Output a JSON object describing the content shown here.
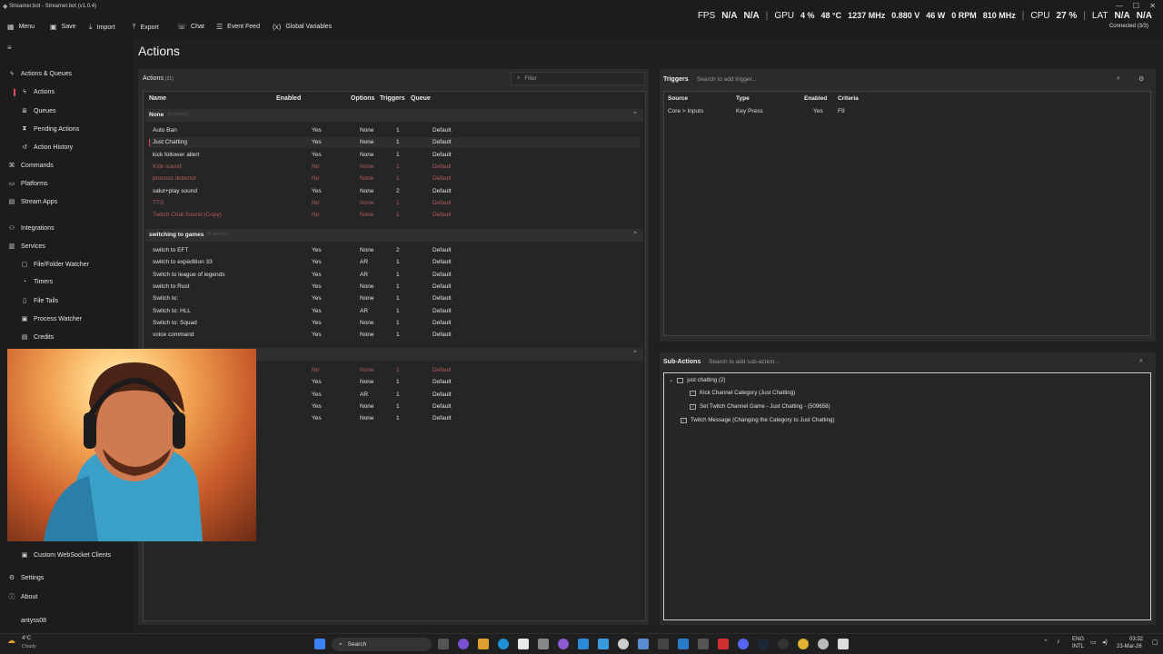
{
  "window": {
    "title": "Streamer.bot - Streamer.bot (v1.0.4)",
    "controls": [
      "—",
      "☐",
      "✕"
    ]
  },
  "menubar": {
    "items": [
      {
        "label": "Menu",
        "icon": "grid-icon"
      },
      {
        "label": "Save",
        "icon": "save-icon"
      },
      {
        "label": "Import",
        "icon": "import-icon"
      },
      {
        "label": "Export",
        "icon": "export-icon"
      },
      {
        "label": "Chat",
        "icon": "chat-icon"
      },
      {
        "label": "Event Feed",
        "icon": "feed-icon"
      },
      {
        "label": "Global Variables",
        "icon": "variables-icon"
      }
    ]
  },
  "overlay": {
    "fps_label": "FPS",
    "fps1": "N/A",
    "fps2": "N/A",
    "gpu_label": "GPU",
    "gpu_pct": "4 %",
    "gpu_temp": "48 °C",
    "gpu_mhz": "1237 MHz",
    "gpu_v": "0.880 V",
    "gpu_w": "46 W",
    "gpu_rpm": "0 RPM",
    "gpu_mem": "810 MHz",
    "cpu_label": "CPU",
    "cpu_pct": "27 %",
    "lat_label": "LAT",
    "lat1": "N/A",
    "lat2": "N/A"
  },
  "connection": {
    "status": "Connected (3/3)"
  },
  "sidebar": {
    "items": [
      {
        "label": "Actions & Queues",
        "icon": "bolt-icon"
      },
      {
        "label": "Actions",
        "icon": "bolt-icon"
      },
      {
        "label": "Queues",
        "icon": "queue-icon"
      },
      {
        "label": "Pending Actions",
        "icon": "pending-icon"
      },
      {
        "label": "Action History",
        "icon": "history-icon"
      },
      {
        "label": "Commands",
        "icon": "command-icon"
      },
      {
        "label": "Platforms",
        "icon": "platform-icon"
      },
      {
        "label": "Stream Apps",
        "icon": "apps-icon"
      },
      {
        "label": "Integrations",
        "icon": "integration-icon"
      },
      {
        "label": "Services",
        "icon": "services-icon"
      },
      {
        "label": "File/Folder Watcher",
        "icon": "folder-icon"
      },
      {
        "label": "Timers",
        "icon": "timer-icon"
      },
      {
        "label": "File Tails",
        "icon": "file-icon"
      },
      {
        "label": "Process Watcher",
        "icon": "process-icon"
      },
      {
        "label": "Credits",
        "icon": "credits-icon"
      },
      {
        "label": "Custom WebSocket Clients",
        "icon": "websocket-icon"
      },
      {
        "label": "Settings",
        "icon": "gear-icon"
      },
      {
        "label": "About",
        "icon": "info-icon"
      },
      {
        "label": "antyss08",
        "icon": "user-icon"
      }
    ]
  },
  "page": {
    "title": "Actions"
  },
  "actions": {
    "header": "Actions",
    "count": "(21)",
    "filter_placeholder": "Filter",
    "columns": [
      "Name",
      "Enabled",
      "Options",
      "Triggers",
      "Queue"
    ],
    "groups": [
      {
        "name": "None",
        "count": "(8 actions)"
      },
      {
        "name": "switching to games",
        "count": "(8 actions)"
      }
    ],
    "rows": [
      {
        "name": "Auto Ban",
        "enabled": "Yes",
        "options": "None",
        "triggers": "1",
        "queue": "Default"
      },
      {
        "name": "Just Chatting",
        "enabled": "Yes",
        "options": "None",
        "triggers": "1",
        "queue": "Default"
      },
      {
        "name": "kick follower allert",
        "enabled": "Yes",
        "options": "None",
        "triggers": "1",
        "queue": "Default"
      },
      {
        "name": "Kick sound",
        "enabled": "No",
        "options": "None",
        "triggers": "1",
        "queue": "Default"
      },
      {
        "name": "process detector",
        "enabled": "No",
        "options": "None",
        "triggers": "1",
        "queue": "Default"
      },
      {
        "name": "salut+play sound",
        "enabled": "Yes",
        "options": "None",
        "triggers": "2",
        "queue": "Default"
      },
      {
        "name": "TTS",
        "enabled": "No",
        "options": "None",
        "triggers": "1",
        "queue": "Default"
      },
      {
        "name": "Twitch Chat Sound (Copy)",
        "enabled": "No",
        "options": "None",
        "triggers": "1",
        "queue": "Default"
      },
      {
        "name": "switch to EFT",
        "enabled": "Yes",
        "options": "None",
        "triggers": "2",
        "queue": "Default"
      },
      {
        "name": "switch to expedition 33",
        "enabled": "Yes",
        "options": "AR",
        "triggers": "1",
        "queue": "Default"
      },
      {
        "name": "Switch to league of legends",
        "enabled": "Yes",
        "options": "AR",
        "triggers": "1",
        "queue": "Default"
      },
      {
        "name": "switch to Rust",
        "enabled": "Yes",
        "options": "None",
        "triggers": "1",
        "queue": "Default"
      },
      {
        "name": "Switch to:",
        "enabled": "Yes",
        "options": "None",
        "triggers": "1",
        "queue": "Default"
      },
      {
        "name": "Switch to: HLL",
        "enabled": "Yes",
        "options": "AR",
        "triggers": "1",
        "queue": "Default"
      },
      {
        "name": "Switch to: Squad",
        "enabled": "Yes",
        "options": "None",
        "triggers": "1",
        "queue": "Default"
      },
      {
        "name": "voice command",
        "enabled": "Yes",
        "options": "None",
        "triggers": "1",
        "queue": "Default"
      },
      {
        "name": "",
        "enabled": "No",
        "options": "None",
        "triggers": "1",
        "queue": "Default"
      },
      {
        "name": "",
        "enabled": "Yes",
        "options": "None",
        "triggers": "1",
        "queue": "Default"
      },
      {
        "name": "",
        "enabled": "Yes",
        "options": "AR",
        "triggers": "1",
        "queue": "Default"
      },
      {
        "name": "",
        "enabled": "Yes",
        "options": "None",
        "triggers": "1",
        "queue": "Default"
      },
      {
        "name": "",
        "enabled": "Yes",
        "options": "None",
        "triggers": "1",
        "queue": "Default"
      }
    ]
  },
  "triggers": {
    "title": "Triggers",
    "search_placeholder": "Search to add trigger...",
    "columns": [
      "Source",
      "Type",
      "Enabled",
      "Criteria"
    ],
    "rows": [
      {
        "source": "Core > Inputs",
        "type": "Key Press",
        "enabled": "Yes",
        "criteria": "F9"
      }
    ]
  },
  "subactions": {
    "title": "Sub-Actions",
    "search_placeholder": "Search to add sub-action...",
    "items": [
      {
        "label": "just chatting (2)"
      },
      {
        "label": "Kick Channel Category (Just Chatting)"
      },
      {
        "label": "Set Twitch Channel Game - Just Chatting - (509658)"
      },
      {
        "label": "Twitch Message (Changing the Category to Just Chatting)"
      }
    ]
  },
  "taskbar": {
    "weather_temp": "4°C",
    "weather_desc": "Cloudy",
    "search_label": "Search",
    "lang": "ENG",
    "lang2": "INTL",
    "time": "03:32",
    "date": "23-Mar-26"
  }
}
